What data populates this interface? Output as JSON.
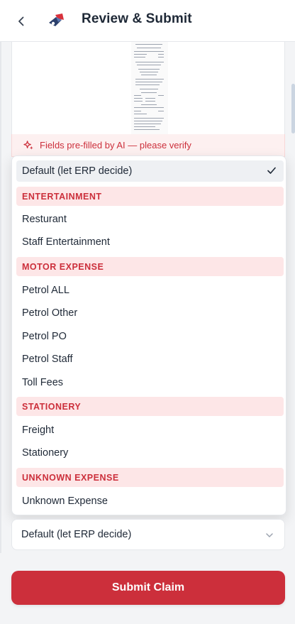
{
  "header": {
    "title": "Review & Submit",
    "back_icon": "chevron-left-icon",
    "logo_icon": "app-logo"
  },
  "ai_banner": {
    "text": "Fields pre-filled by AI — please verify",
    "icon": "sparkles-icon"
  },
  "dropdown": {
    "selected_option": "Default (let ERP decide)",
    "groups": [
      {
        "label": "ENTERTAINMENT",
        "options": [
          "Resturant",
          "Staff Entertainment"
        ]
      },
      {
        "label": "MOTOR EXPENSE",
        "options": [
          "Petrol ALL",
          "Petrol Other",
          "Petrol PO",
          "Petrol Staff",
          "Toll Fees"
        ]
      },
      {
        "label": "STATIONERY",
        "options": [
          "Freight",
          "Stationery"
        ]
      },
      {
        "label": "UNKNOWN EXPENSE",
        "options": [
          "Unknown Expense"
        ]
      }
    ]
  },
  "select": {
    "value": "Default (let ERP decide)",
    "icon": "chevron-down-icon"
  },
  "submit": {
    "label": "Submit Claim"
  },
  "colors": {
    "accent": "#cc2f3b",
    "group_bg": "#fde6e7",
    "banner_bg": "#fdf0f0"
  }
}
